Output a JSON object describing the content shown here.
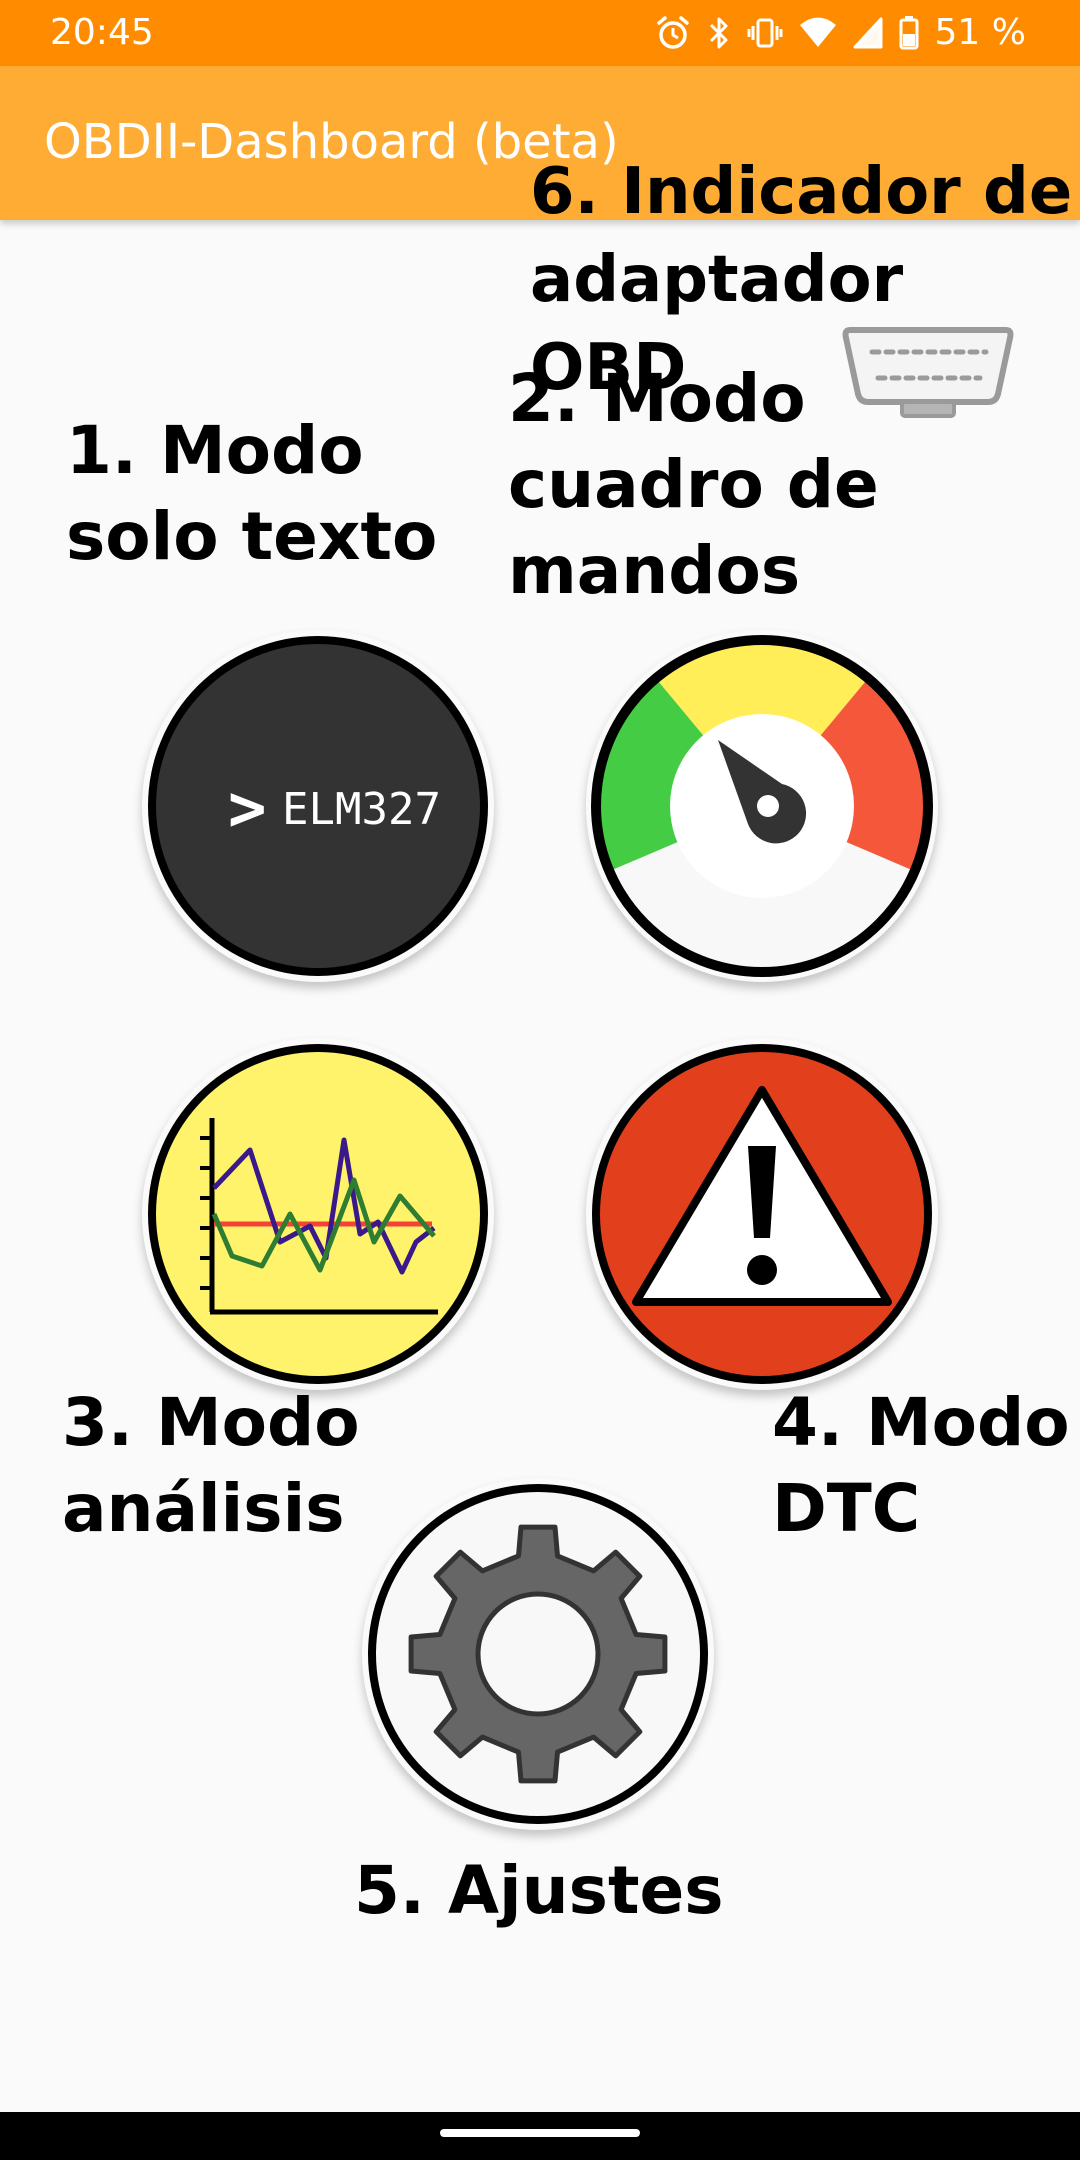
{
  "status_bar": {
    "time": "20:45",
    "battery_percent": "51 %",
    "icons": [
      "alarm-icon",
      "bluetooth-icon",
      "vibrate-icon",
      "wifi-icon",
      "cell-signal-icon",
      "battery-icon"
    ],
    "battery_level": 0.51
  },
  "app_bar": {
    "title": "OBDII-Dashboard (beta)",
    "color": "#ffac35"
  },
  "colors": {
    "status_bar": "#ff8c00",
    "background": "#fafafa",
    "text_mode_button": "#333333",
    "analysis_button": "#fff36b",
    "dtc_button": "#e2401c",
    "settings_gear": "#666666",
    "gauge_green": "#44cc44",
    "gauge_yellow": "#ffee58",
    "gauge_red": "#f4573a"
  },
  "labels": {
    "obd_indicator": "6. Indicador de\nadaptador OBD",
    "dashboard_mode": "2. Modo\ncuadro de\nmandos",
    "text_mode": "1. Modo\nsolo texto",
    "analysis_mode": "3. Modo\nanálisis",
    "dtc_mode": "4. Modo\nDTC",
    "settings": "5. Ajustes"
  },
  "buttons": {
    "text_mode": {
      "prompt_symbol": ">",
      "prompt_text": "ELM327",
      "icon": "terminal-icon"
    },
    "dashboard_mode": {
      "icon": "speedometer-gauge-icon"
    },
    "analysis_mode": {
      "icon": "line-chart-icon"
    },
    "dtc_mode": {
      "icon": "warning-triangle-icon"
    },
    "settings": {
      "icon": "gear-icon"
    }
  },
  "obd_indicator": {
    "icon": "obd-connector-icon"
  }
}
